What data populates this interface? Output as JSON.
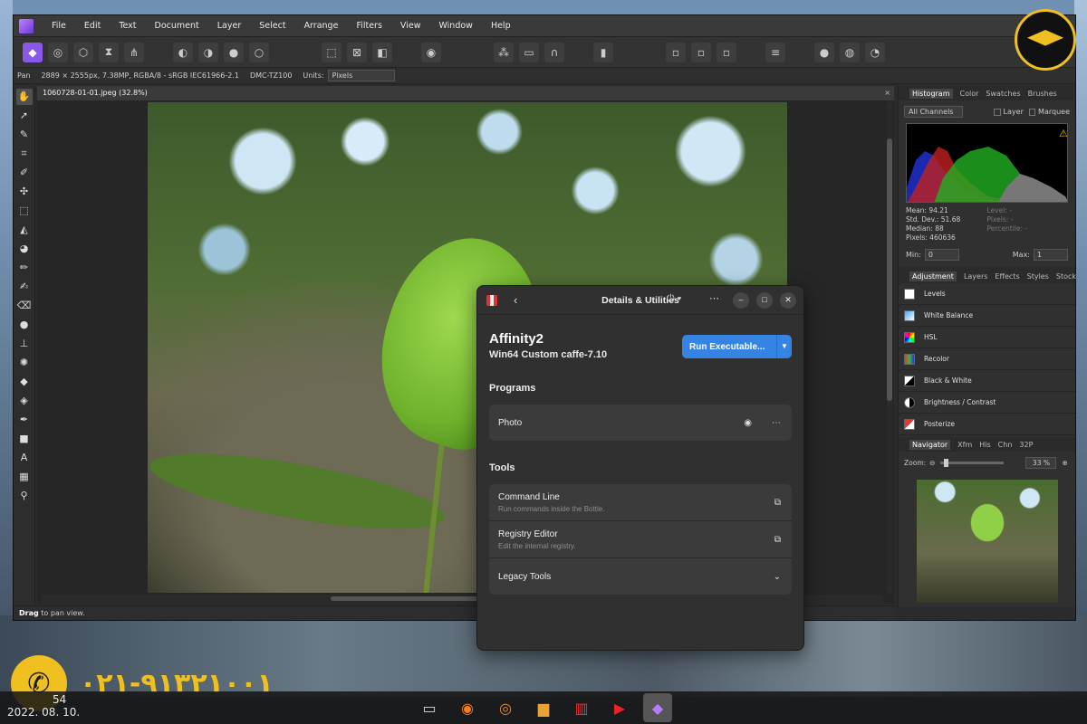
{
  "menu": {
    "items": [
      "File",
      "Edit",
      "Text",
      "Document",
      "Layer",
      "Select",
      "Arrange",
      "Filters",
      "View",
      "Window",
      "Help"
    ]
  },
  "context": {
    "tool": "Pan",
    "info": "2889 × 2555px, 7.38MP, RGBA/8 - sRGB IEC61966-2.1",
    "camera": "DMC-TZ100",
    "units_label": "Units:",
    "units_value": "Pixels"
  },
  "document": {
    "tab": "1060728-01-01.jpeg (32.8%)",
    "close": "×"
  },
  "status": {
    "bold": "Drag",
    "rest": " to pan view."
  },
  "histogram": {
    "tabs": [
      "Histogram",
      "Color",
      "Swatches",
      "Brushes"
    ],
    "channel": "All Channels",
    "layer_label": "Layer",
    "marquee_label": "Marquee",
    "mean": "Mean: 94.21",
    "stddev": "Std. Dev.: 51.68",
    "median": "Median: 88",
    "pixels": "Pixels: 460636",
    "level": "Level: -",
    "pixels_r": "Pixels: -",
    "percentile": "Percentile: -",
    "min_label": "Min:",
    "min_value": "0",
    "max_label": "Max:",
    "max_value": "1"
  },
  "adjustment": {
    "tabs": [
      "Adjustment",
      "Layers",
      "Effects",
      "Styles",
      "Stock"
    ],
    "items": [
      "Levels",
      "White Balance",
      "HSL",
      "Recolor",
      "Black & White",
      "Brightness / Contrast",
      "Posterize"
    ]
  },
  "navigator": {
    "tabs": [
      "Navigator",
      "Xfm",
      "His",
      "Chn",
      "32P"
    ],
    "zoom_label": "Zoom:",
    "zoom_value": "33 %"
  },
  "bottles": {
    "title": "Details & Utilities",
    "name": "Affinity2",
    "subtitle": "Win64 Custom caffe-7.10",
    "run_label": "Run Executable...",
    "programs_heading": "Programs",
    "program": "Photo",
    "tools_heading": "Tools",
    "tools": [
      {
        "title": "Command Line",
        "subtitle": "Run commands inside the Bottle."
      },
      {
        "title": "Registry Editor",
        "subtitle": "Edit the internal registry."
      },
      {
        "title": "Legacy Tools",
        "subtitle": ""
      }
    ]
  },
  "overlay": {
    "phone": "۰۲۱-۹۱۳۲۱۰۰۱",
    "clock_time": "54",
    "clock_date": "2022. 08. 10."
  },
  "colors": {
    "accent": "#3584e4",
    "affinity_purple": "#8a58e8",
    "brand_yellow": "#f0c020"
  }
}
